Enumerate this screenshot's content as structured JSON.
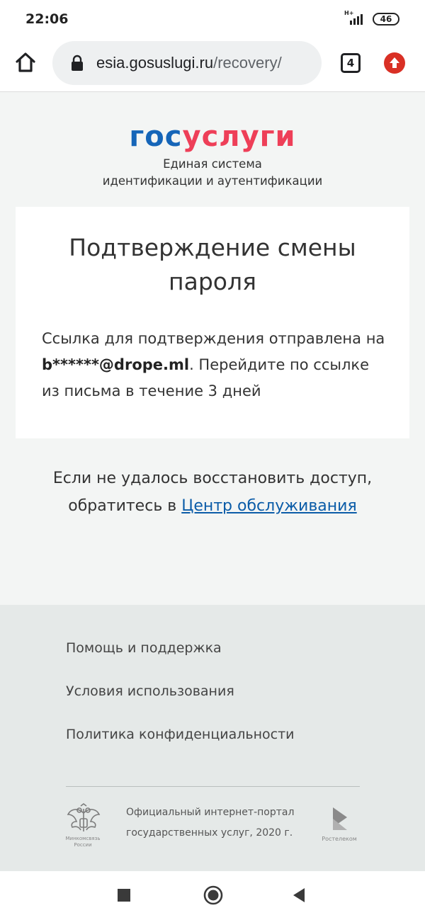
{
  "status": {
    "time": "22:06",
    "network": "H+",
    "battery": "46"
  },
  "browser": {
    "url_host": "esia.gosuslugi.ru",
    "url_path": "/recovery/",
    "tabs_count": "4"
  },
  "header": {
    "logo_part1": "гос",
    "logo_part2": "услуги",
    "tagline_line1": "Единая система",
    "tagline_line2": "идентификации и аутентификации"
  },
  "card": {
    "title": "Подтверждение смены пароля",
    "text_before": "Ссылка для подтверждения отправлена на ",
    "email": "b******@drope.ml",
    "text_after": ". Перейдите по ссылке из письма в течение 3 дней"
  },
  "help": {
    "line1": "Если не удалось восстановить доступ,",
    "line2_prefix": "обратитесь в ",
    "link_label": "Центр обслуживания"
  },
  "footer": {
    "links": [
      "Помощь и поддержка",
      "Условия использования",
      "Политика конфиденциальности"
    ],
    "emblem_caption_1": "Минкомсвязь",
    "emblem_caption_2": "России",
    "note_line1": "Официальный интернет-портал",
    "note_line2": "государственных услуг, 2020 г.",
    "rt_caption": "Ростелеком"
  },
  "colors": {
    "logo_blue": "#1565b8",
    "logo_red": "#ee3f58",
    "link": "#0b5ca8",
    "update_badge": "#d93025"
  }
}
